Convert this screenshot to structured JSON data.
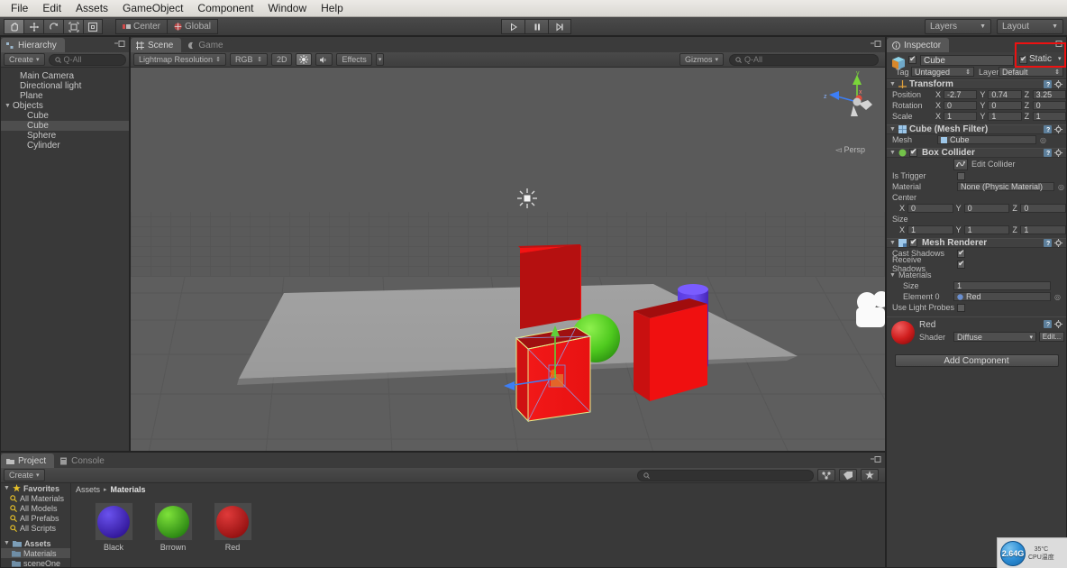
{
  "menubar": {
    "items": [
      "File",
      "Edit",
      "Assets",
      "GameObject",
      "Component",
      "Window",
      "Help"
    ]
  },
  "toolbar": {
    "tools": [
      "hand-tool",
      "move-tool",
      "rotate-tool",
      "scale-tool",
      "rect-tool"
    ],
    "pivot_mode": "Center",
    "handle_space": "Global",
    "play": "play-button",
    "pause": "pause-button",
    "step": "step-button",
    "layers_label": "Layers",
    "layout_label": "Layout"
  },
  "hierarchy": {
    "tab": "Hierarchy",
    "create_label": "Create",
    "search_placeholder": "Q-All",
    "items": [
      {
        "label": "Main Camera",
        "depth": 1,
        "expandable": false,
        "selected": false
      },
      {
        "label": "Directional light",
        "depth": 1,
        "expandable": false,
        "selected": false
      },
      {
        "label": "Plane",
        "depth": 1,
        "expandable": false,
        "selected": false
      },
      {
        "label": "Objects",
        "depth": 0,
        "expandable": true,
        "selected": false
      },
      {
        "label": "Cube",
        "depth": 2,
        "expandable": false,
        "selected": false
      },
      {
        "label": "Cube",
        "depth": 2,
        "expandable": false,
        "selected": true
      },
      {
        "label": "Sphere",
        "depth": 2,
        "expandable": false,
        "selected": false
      },
      {
        "label": "Cylinder",
        "depth": 2,
        "expandable": false,
        "selected": false
      }
    ]
  },
  "scene": {
    "tabs": [
      {
        "label": "Scene",
        "active": true
      },
      {
        "label": "Game",
        "active": false
      }
    ],
    "draw_mode": "Lightmap Resolution",
    "color_mode": "RGB",
    "two_d": "2D",
    "lighting": "lighting-toggle",
    "audio": "audio-toggle",
    "effects": "Effects",
    "gizmos": "Gizmos",
    "search_placeholder": "Q-All",
    "projection_label": "Persp",
    "axis_labels": {
      "x": "x",
      "y": "y",
      "z": "z"
    }
  },
  "inspector": {
    "tab": "Inspector",
    "object_name": "Cube",
    "object_enabled": true,
    "static_label": "Static",
    "static_checked": true,
    "tag_label": "Tag",
    "tag_value": "Untagged",
    "layer_label": "Layer",
    "layer_value": "Default",
    "highlight_color": "#ee1111",
    "components": [
      {
        "name": "Transform",
        "icon": "transform-icon",
        "rows": [
          {
            "label": "Position",
            "x": "-2.7",
            "y": "0.74",
            "z": "3.25"
          },
          {
            "label": "Rotation",
            "x": "0",
            "y": "0",
            "z": "0"
          },
          {
            "label": "Scale",
            "x": "1",
            "y": "1",
            "z": "1"
          }
        ]
      },
      {
        "name": "Cube (Mesh Filter)",
        "icon": "mesh-filter-icon",
        "mesh_label": "Mesh",
        "mesh_value": "Cube"
      },
      {
        "name": "Box Collider",
        "icon": "box-collider-icon",
        "enabled": true,
        "edit_collider_label": "Edit Collider",
        "is_trigger_label": "Is Trigger",
        "is_trigger_checked": false,
        "material_label": "Material",
        "material_value": "None (Physic Material)",
        "center_label": "Center",
        "center": {
          "x": "0",
          "y": "0",
          "z": "0"
        },
        "size_label": "Size",
        "size": {
          "x": "1",
          "y": "1",
          "z": "1"
        }
      },
      {
        "name": "Mesh Renderer",
        "icon": "mesh-renderer-icon",
        "enabled": true,
        "cast_shadows_label": "Cast Shadows",
        "cast_shadows_checked": true,
        "receive_shadows_label": "Receive Shadows",
        "receive_shadows_checked": true,
        "materials_label": "Materials",
        "size_label": "Size",
        "size_value": "1",
        "element0_label": "Element 0",
        "element0_value": "Red",
        "light_probes_label": "Use Light Probes",
        "light_probes_checked": false
      }
    ],
    "material_preview": {
      "name": "Red",
      "color": "#c91d1d",
      "shader_label": "Shader",
      "shader_value": "Diffuse",
      "edit_label": "Edit..."
    },
    "add_component_label": "Add Component"
  },
  "project": {
    "tabs": [
      {
        "label": "Project",
        "active": true
      },
      {
        "label": "Console",
        "active": false
      }
    ],
    "create_label": "Create",
    "search_placeholder": "",
    "favorites_label": "Favorites",
    "favorites": [
      "All Materials",
      "All Models",
      "All Prefabs",
      "All Scripts"
    ],
    "assets_label": "Assets",
    "folders": [
      {
        "label": "Materials",
        "selected": true
      },
      {
        "label": "sceneOne",
        "selected": false
      }
    ],
    "breadcrumb": [
      "Assets",
      "Materials"
    ],
    "assets": [
      {
        "name": "Black",
        "color_light": "#6a52ee",
        "color_dark": "#2a0f8e"
      },
      {
        "name": "Brrown",
        "color_light": "#7ee23a",
        "color_dark": "#1f7a0d"
      },
      {
        "name": "Red",
        "color_light": "#e03a3a",
        "color_dark": "#8a0b0b"
      }
    ]
  },
  "tray": {
    "memory": "2.64G",
    "temperature": "35°C",
    "temp_label": "CPU温度"
  }
}
